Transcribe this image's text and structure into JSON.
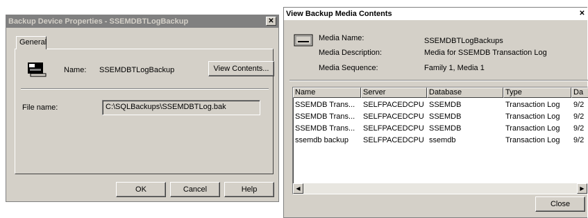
{
  "left_dialog": {
    "title": "Backup Device Properties - SSEMDBTLogBackup",
    "close_glyph": "✕",
    "tab_general": "General",
    "name_label": "Name:",
    "name_value": "SSEMDBTLogBackup",
    "view_contents_button": "View Contents...",
    "file_name_label": "File name:",
    "file_name_value": "C:\\SQLBackups\\SSEMDBTLog.bak",
    "ok_button": "OK",
    "cancel_button": "Cancel",
    "help_button": "Help",
    "device_icon": "tape-device-icon"
  },
  "right_dialog": {
    "title": "View Backup Media Contents",
    "close_glyph": "✕",
    "media_icon": "media-drive-icon",
    "media_name_label": "Media Name:",
    "media_name_value": "SSEMDBTLogBackups",
    "media_description_label": "Media Description:",
    "media_description_value": "Media for SSEMDB Transaction Log",
    "media_sequence_label": "Media Sequence:",
    "media_sequence_value": "Family 1, Media 1",
    "table": {
      "columns": [
        "Name",
        "Server",
        "Database",
        "Type",
        "Da"
      ],
      "rows": [
        [
          "SSEMDB Trans...",
          "SELFPACEDCPU",
          "SSEMDB",
          "Transaction Log",
          "9/2"
        ],
        [
          "SSEMDB Trans...",
          "SELFPACEDCPU",
          "SSEMDB",
          "Transaction Log",
          "9/2"
        ],
        [
          "SSEMDB Trans...",
          "SELFPACEDCPU",
          "SSEMDB",
          "Transaction Log",
          "9/2"
        ],
        [
          "ssemdb backup",
          "SELFPACEDCPU",
          "ssemdb",
          "Transaction Log",
          "9/2"
        ]
      ]
    },
    "scroll_left": "◀",
    "scroll_right": "▶",
    "close_button": "Close"
  }
}
